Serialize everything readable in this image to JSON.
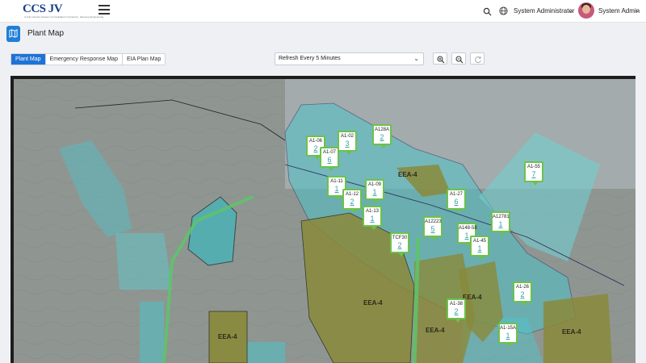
{
  "header": {
    "logo_text": "CCS JV",
    "logo_subtitle": "A Joint Venture between Consolidated Contractors, Samsung Engineering",
    "role": "System Administrator",
    "user": "System Admin"
  },
  "page": {
    "title": "Plant Map"
  },
  "tabs": [
    {
      "label": "Plant Map",
      "active": true
    },
    {
      "label": "Emergency Response Map",
      "active": false
    },
    {
      "label": "EIA Plan Map",
      "active": false
    }
  ],
  "refresh": {
    "selected": "Refresh Every 5 Minutes"
  },
  "pins": [
    {
      "name": "A1-06",
      "count": "2"
    },
    {
      "name": "A1-02",
      "count": "3"
    },
    {
      "name": "A128A",
      "count": "2"
    },
    {
      "name": "A1-07",
      "count": "6"
    },
    {
      "name": "A1-11",
      "count": "1"
    },
    {
      "name": "A1-12",
      "count": "2"
    },
    {
      "name": "A1-09",
      "count": "1"
    },
    {
      "name": "A1-13",
      "count": "1"
    },
    {
      "name": "A1-55",
      "count": "7"
    },
    {
      "name": "A1-27",
      "count": "6"
    },
    {
      "name": "A12781",
      "count": "1"
    },
    {
      "name": "A12223",
      "count": "5"
    },
    {
      "name": "A148-58",
      "count": "1"
    },
    {
      "name": "A1-45",
      "count": "1"
    },
    {
      "name": "TCF30",
      "count": "2"
    },
    {
      "name": "A1-26",
      "count": "2"
    },
    {
      "name": "A1-38",
      "count": "2"
    },
    {
      "name": "A1-15A",
      "count": "1"
    }
  ],
  "zones": [
    "EEA-4",
    "EEA-4",
    "EEA-4",
    "EEA-4",
    "EEA-4",
    "EEA-4"
  ],
  "colors": {
    "accent": "#1e73d6",
    "pin_border": "#6cc24a",
    "teal_area": "#4fc3c9",
    "olive_area": "#8a8a3a"
  }
}
